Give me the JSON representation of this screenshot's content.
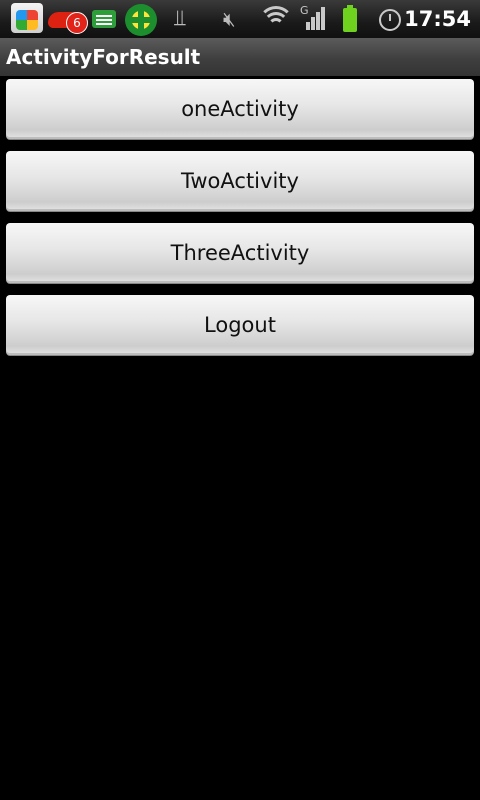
{
  "status_bar": {
    "time": "17:54",
    "notification_badge": "6",
    "network_type": "G",
    "icons": [
      "app-store-icon",
      "weibo-bird-icon",
      "messages-icon",
      "security-plus-icon",
      "usb-icon",
      "mute-icon",
      "wifi-icon",
      "signal-icon",
      "battery-icon",
      "alarm-icon"
    ],
    "battery_color": "#6ed21e"
  },
  "titlebar": {
    "title": "ActivityForResult"
  },
  "buttons": {
    "one": "oneActivity",
    "two": "TwoActivity",
    "three": "ThreeActivity",
    "logout": "Logout"
  }
}
